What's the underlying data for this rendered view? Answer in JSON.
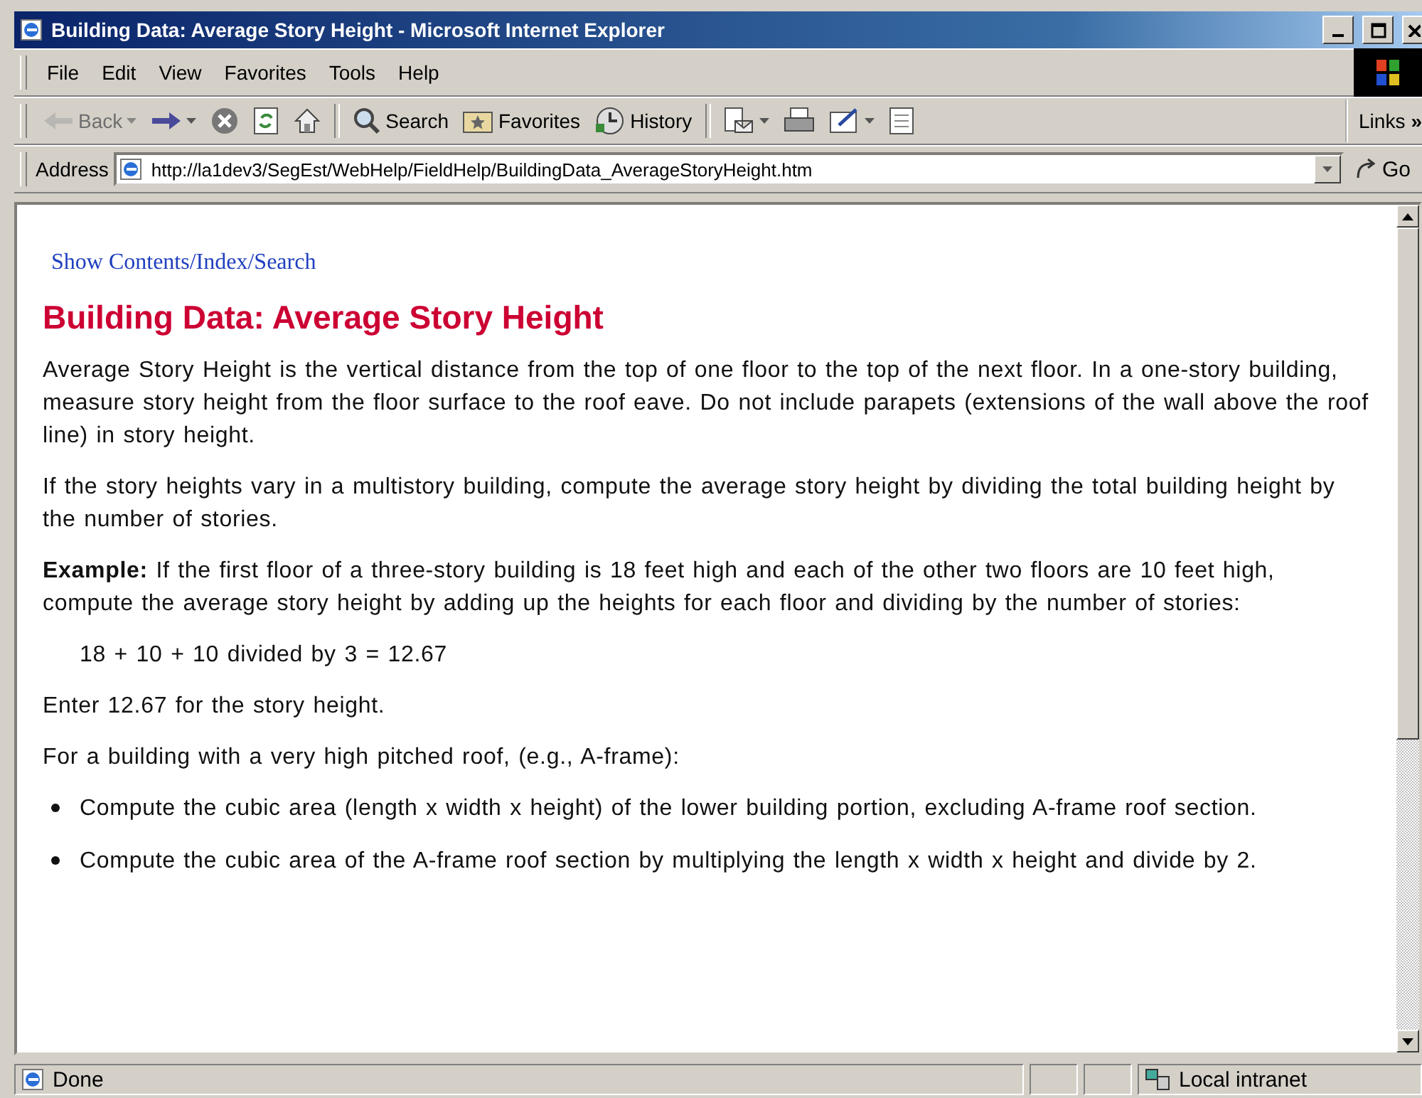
{
  "window": {
    "title": "Building Data: Average Story Height - Microsoft Internet Explorer"
  },
  "menu": [
    "File",
    "Edit",
    "View",
    "Favorites",
    "Tools",
    "Help"
  ],
  "toolbar": [
    {
      "kind": "back",
      "label": "Back",
      "disabled": true,
      "dropdown": true
    },
    {
      "kind": "forward",
      "disabled": false,
      "dropdown": true
    },
    {
      "kind": "stop",
      "disabled": false,
      "dropdown": false
    },
    {
      "kind": "refresh",
      "disabled": false,
      "dropdown": false
    },
    {
      "kind": "home",
      "disabled": false,
      "dropdown": false
    },
    {
      "kind": "separator"
    },
    {
      "kind": "search",
      "label": "Search",
      "disabled": false,
      "dropdown": false
    },
    {
      "kind": "favorites",
      "label": "Favorites",
      "disabled": false,
      "dropdown": false
    },
    {
      "kind": "history",
      "label": "History",
      "disabled": false,
      "dropdown": false
    },
    {
      "kind": "separator"
    },
    {
      "kind": "mail",
      "disabled": false,
      "dropdown": true
    },
    {
      "kind": "print",
      "disabled": false,
      "dropdown": false
    },
    {
      "kind": "edit",
      "disabled": false,
      "dropdown": true
    },
    {
      "kind": "discuss",
      "disabled": false,
      "dropdown": false
    }
  ],
  "links": {
    "label": "Links",
    "more": "»"
  },
  "address": {
    "label": "Address",
    "value": "http://la1dev3/SegEst/WebHelp/FieldHelp/BuildingData_AverageStoryHeight.htm",
    "go": "Go"
  },
  "page": {
    "nav_link": "Show Contents/Index/Search",
    "heading": "Building Data: Average Story Height",
    "blocks": [
      {
        "kind": "para",
        "text": "Average Story Height is the vertical distance from the top of one floor to the top of the next floor.  In a one-story building, measure story height from the floor surface to the roof eave.  Do not include parapets (extensions of the wall above the roof line) in story height."
      },
      {
        "kind": "para",
        "text": "If the story heights vary in a multistory building, compute the average story height by dividing the total building height by the number of stories."
      },
      {
        "kind": "para",
        "text": "**Example:** If the first floor of a three-story building is 18 feet high and each of the other two floors are 10 feet high, compute the average story height by adding up the heights for each floor and dividing by the number of stories:"
      },
      {
        "kind": "indent",
        "text": "18 + 10 + 10 divided by 3 = 12.67"
      },
      {
        "kind": "para",
        "text": "Enter 12.67 for the story height."
      },
      {
        "kind": "para",
        "text": "For a building with a very high pitched roof, (e.g., A-frame):"
      },
      {
        "kind": "bullet",
        "text": "Compute the cubic area (length x width x height) of the lower building portion, excluding A-frame roof section."
      },
      {
        "kind": "bullet",
        "text": "Compute the cubic area of the A-frame roof section by multiplying the length x width x height and divide by 2."
      }
    ]
  },
  "status_bar": {
    "text": "Done",
    "zone": "Local intranet"
  }
}
